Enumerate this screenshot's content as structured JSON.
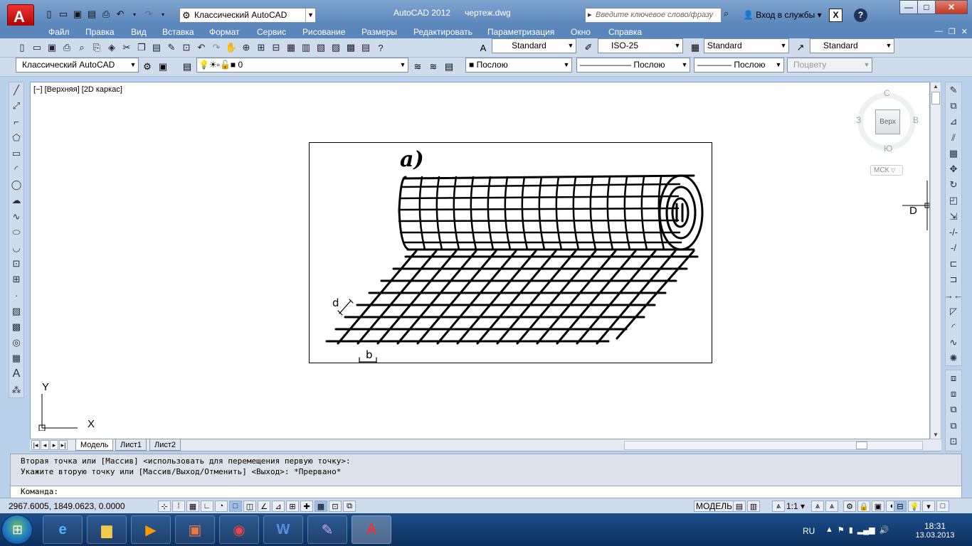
{
  "titlebar": {
    "app_title": "AutoCAD 2012",
    "file_name": "чертеж.dwg",
    "workspace": "Классический AutoCAD",
    "search_placeholder": "Введите ключевое слово/фразу",
    "login": "Вход в службы",
    "help": "?",
    "x_icon": "X"
  },
  "window_controls": {
    "minimize": "—",
    "maximize": "□",
    "close": "✕"
  },
  "menu": {
    "items": [
      "Файл",
      "Правка",
      "Вид",
      "Вставка",
      "Формат",
      "Сервис",
      "Рисование",
      "Размеры",
      "Редактировать",
      "Параметризация",
      "Окно",
      "Справка"
    ],
    "mdi": [
      "—",
      "❐",
      "✕"
    ]
  },
  "toolbar_styles": {
    "text_style": "Standard",
    "dim_style": "ISO-25",
    "table_style": "Standard",
    "multileader_style": "Standard"
  },
  "toolbar_layers": {
    "workspace": "Классический AutoCAD",
    "layer": "0",
    "color": "Послою",
    "linetype": "Послою",
    "lineweight": "Послою",
    "plotstyle": "Поцвету"
  },
  "viewport": {
    "label": "[−] [Верхняя] [2D каркас]",
    "figure_label": "а)",
    "label_d": "d",
    "label_b": "b",
    "cursor_label": "D"
  },
  "viewcube": {
    "face": "Верх",
    "north": "С",
    "south": "Ю",
    "west": "З",
    "east": "В",
    "wcs": "МСК"
  },
  "ucs": {
    "y": "Y",
    "x": "X"
  },
  "tabs": [
    "Модель",
    "Лист1",
    "Лист2"
  ],
  "command": {
    "line1": "Вторая точка или [Массив] <использовать для перемещения первую точку>:",
    "line2": "Укажите вторую точку или [Массив/Выход/Отменить] <Выход>: *Прервано*",
    "prompt": "Команда:"
  },
  "status": {
    "coords": "2967.6005, 1849.0623, 0.0000",
    "model": "МОДЕЛЬ",
    "scale": "1:1"
  },
  "tray": {
    "lang": "RU",
    "time": "18:31",
    "date": "13.03.2013"
  },
  "colors": {
    "titlebar": "#5b86bb",
    "toolbar": "#cfdcec",
    "taskbar": "#0c2f5e"
  }
}
